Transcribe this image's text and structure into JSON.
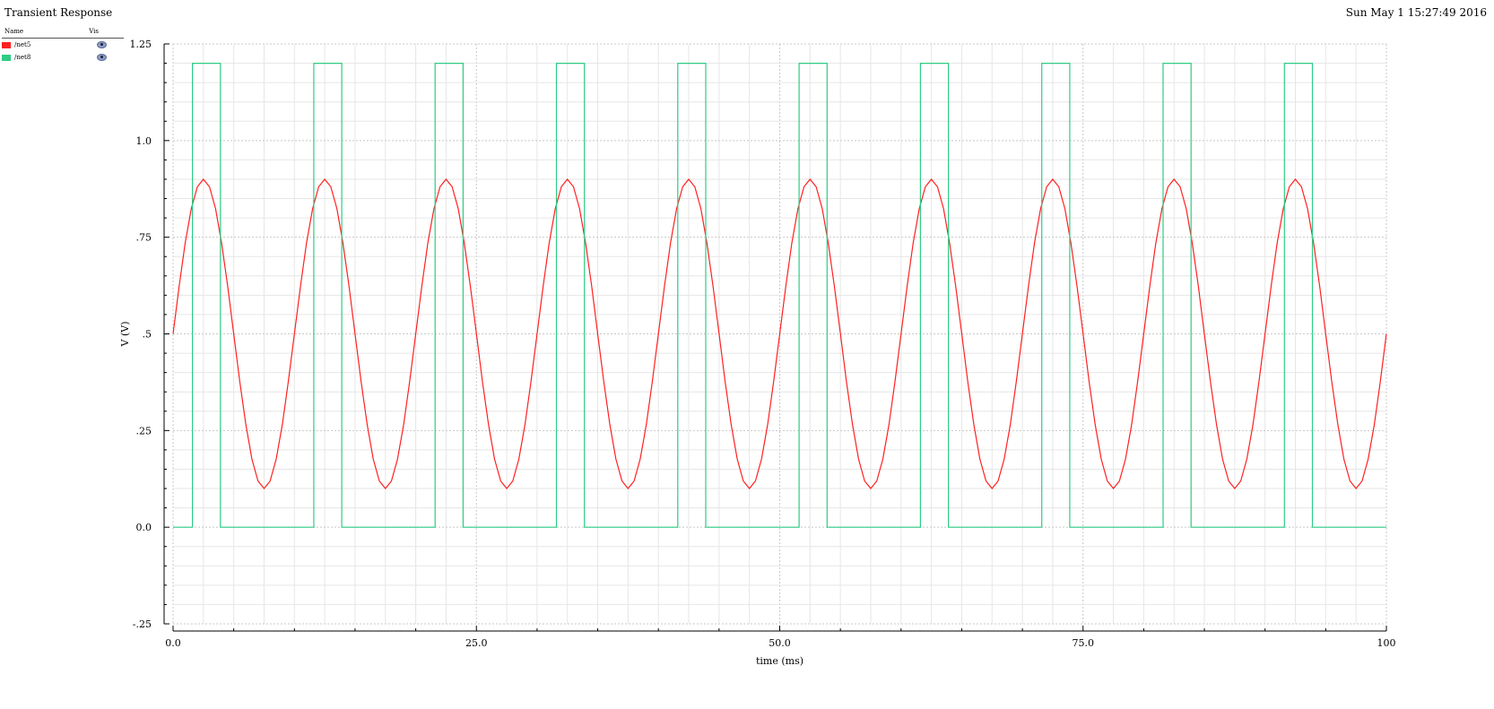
{
  "window": {
    "title": "Transient Response",
    "timestamp": "Sun May 1 15:27:49 2016"
  },
  "legend": {
    "col_name": "Name",
    "col_vis": "Vis",
    "items": [
      {
        "label": "/net5",
        "color": "#ff2020",
        "visible_icon": "eye-icon"
      },
      {
        "label": "/net8",
        "color": "#2ecc85",
        "visible_icon": "eye-icon"
      }
    ]
  },
  "chart_data": {
    "type": "line",
    "title": "Transient Response",
    "xlabel": "time (ms)",
    "ylabel": "V (V)",
    "xlim": [
      0,
      100
    ],
    "ylim": [
      -0.25,
      1.25
    ],
    "x_ticks": [
      0,
      25,
      50,
      75,
      100
    ],
    "x_tick_labels": [
      "0.0",
      "25.0",
      "50.0",
      "75.0",
      "100"
    ],
    "y_ticks": [
      -0.25,
      0,
      0.25,
      0.5,
      0.75,
      1.0,
      1.25
    ],
    "y_tick_labels": [
      "-.25",
      "0.0",
      ".25",
      ".5",
      ".75",
      "1.0",
      "1.25"
    ],
    "grid": true,
    "series": [
      {
        "name": "/net5",
        "color": "#ff2020",
        "kind": "sine",
        "offset": 0.5,
        "amplitude": 0.4,
        "period": 10,
        "phase_start": 0,
        "x_range": [
          0,
          100
        ]
      },
      {
        "name": "/net8",
        "color": "#2ecc85",
        "kind": "pulse",
        "low": 0.0,
        "high": 1.2,
        "period": 10,
        "rise_at": 1.6,
        "fall_at": 3.9,
        "x_range": [
          0,
          100
        ]
      }
    ]
  }
}
